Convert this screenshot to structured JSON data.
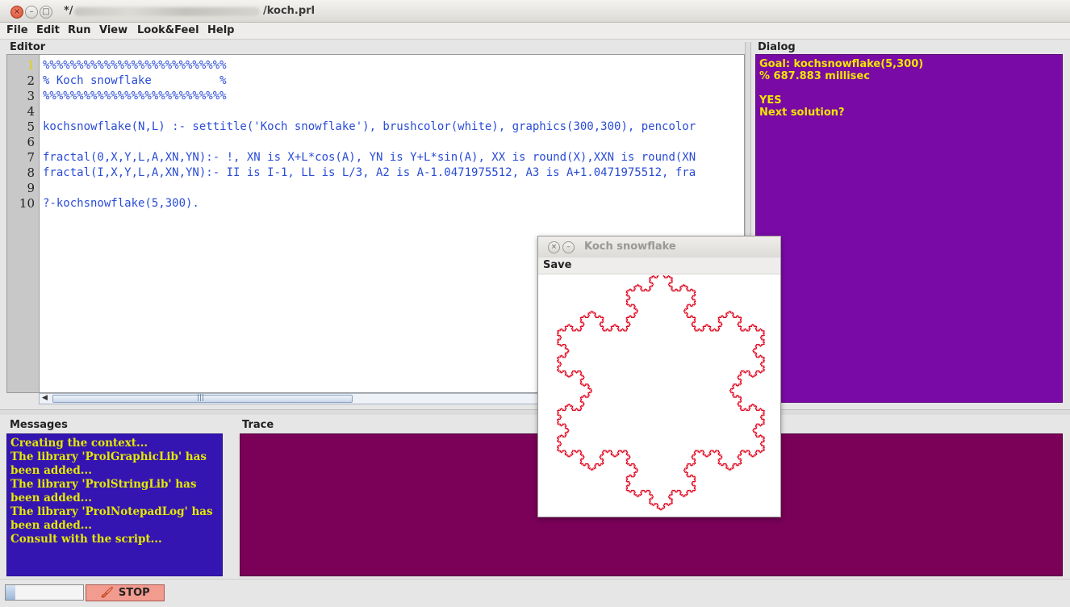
{
  "window": {
    "title_prefix": "*/",
    "title_suffix": "/koch.prl",
    "close_glyph": "×",
    "minimize_glyph": "–",
    "maximize_glyph": "□"
  },
  "menu": [
    "File",
    "Edit",
    "Run",
    "View",
    "Look&Feel",
    "Help"
  ],
  "editor": {
    "title": "Editor",
    "line_numbers": [
      "1",
      "2",
      "3",
      "4",
      "5",
      "6",
      "7",
      "8",
      "9",
      "10"
    ],
    "lines": [
      "%%%%%%%%%%%%%%%%%%%%%%%%%%%",
      "% Koch snowflake          %",
      "%%%%%%%%%%%%%%%%%%%%%%%%%%%",
      "",
      "kochsnowflake(N,L) :- settitle('Koch snowflake'), brushcolor(white), graphics(300,300), pencolor",
      "",
      "fractal(0,X,Y,L,A,XN,YN):- !, XN is X+L*cos(A), YN is Y+L*sin(A), XX is round(X),XXN is round(XN",
      "fractal(I,X,Y,L,A,XN,YN):- II is I-1, LL is L/3, A2 is A-1.0471975512, A3 is A+1.0471975512, fra",
      "",
      "?-kochsnowflake(5,300)."
    ],
    "text_color": "#2a4cd6",
    "scroll_grip": "|||"
  },
  "dialog": {
    "title": "Dialog",
    "lines": [
      "Goal: kochsnowflake(5,300)",
      "% 687.883 millisec",
      "",
      "YES",
      "Next solution?"
    ],
    "bg_color": "#7a0aa6",
    "text_color": "#f1e600"
  },
  "messages": {
    "title": "Messages",
    "lines": [
      "Creating the context...",
      "The library 'ProlGraphicLib' has been added...",
      "The library 'ProlStringLib' has been added...",
      "The library 'ProlNotepadLog' has been added...",
      "Consult with the script..."
    ],
    "bg_color": "#3515b2",
    "text_color": "#e3e800"
  },
  "trace": {
    "title": "Trace",
    "bg_color": "#7a0058"
  },
  "statusbar": {
    "stop_label": "STOP",
    "stop_icon": "🖌"
  },
  "koch_window": {
    "title": "Koch snowflake",
    "save_label": "Save",
    "close_glyph": "×",
    "minimize_glyph": "–",
    "pen_color": "#e0001a",
    "background": "#ffffff",
    "fractal_level": 5,
    "side_length": 300
  }
}
